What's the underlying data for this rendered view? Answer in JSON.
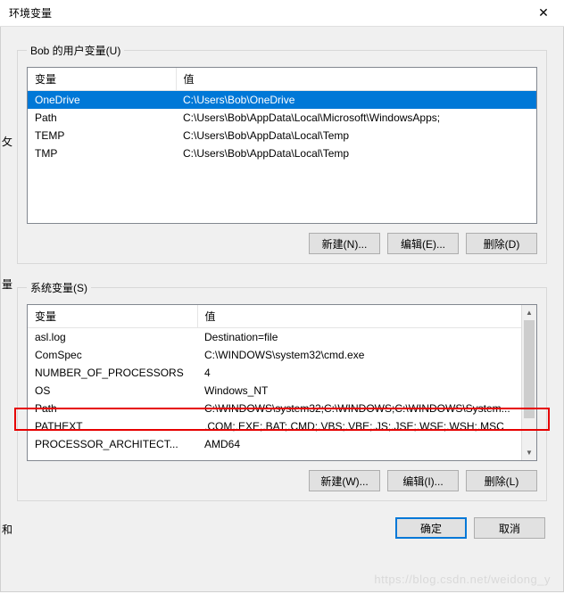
{
  "window": {
    "title": "环境变量"
  },
  "user_vars": {
    "legend": "Bob 的用户变量(U)",
    "columns": {
      "var": "变量",
      "val": "值"
    },
    "rows": [
      {
        "name": "OneDrive",
        "value": "C:\\Users\\Bob\\OneDrive"
      },
      {
        "name": "Path",
        "value": "C:\\Users\\Bob\\AppData\\Local\\Microsoft\\WindowsApps;"
      },
      {
        "name": "TEMP",
        "value": "C:\\Users\\Bob\\AppData\\Local\\Temp"
      },
      {
        "name": "TMP",
        "value": "C:\\Users\\Bob\\AppData\\Local\\Temp"
      }
    ],
    "buttons": {
      "new": "新建(N)...",
      "edit": "编辑(E)...",
      "del": "删除(D)"
    }
  },
  "sys_vars": {
    "legend": "系统变量(S)",
    "columns": {
      "var": "变量",
      "val": "值"
    },
    "rows": [
      {
        "name": "asl.log",
        "value": "Destination=file"
      },
      {
        "name": "ComSpec",
        "value": "C:\\WINDOWS\\system32\\cmd.exe"
      },
      {
        "name": "NUMBER_OF_PROCESSORS",
        "value": "4"
      },
      {
        "name": "OS",
        "value": "Windows_NT"
      },
      {
        "name": "Path",
        "value": "C:\\WINDOWS\\system32;C:\\WINDOWS;C:\\WINDOWS\\System..."
      },
      {
        "name": "PATHEXT",
        "value": ".COM;.EXE;.BAT;.CMD;.VBS;.VBE;.JS;.JSE;.WSF;.WSH;.MSC"
      },
      {
        "name": "PROCESSOR_ARCHITECT...",
        "value": "AMD64"
      }
    ],
    "buttons": {
      "new": "新建(W)...",
      "edit": "编辑(I)...",
      "del": "删除(L)"
    }
  },
  "dialog_buttons": {
    "ok": "确定",
    "cancel": "取消"
  },
  "edge": {
    "e1": "攵",
    "e2": "量",
    "e3": "和"
  },
  "watermark": "https://blog.csdn.net/weidong_y"
}
